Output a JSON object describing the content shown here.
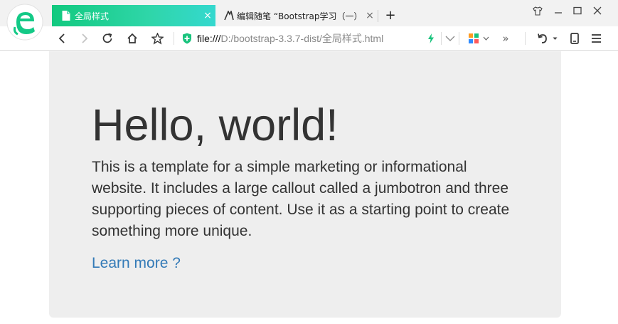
{
  "browser": {
    "tabs": [
      {
        "title": "全局样式",
        "close": "×",
        "active": true
      },
      {
        "title": "编辑随笔 “Bootstrap学习（一）",
        "close": "×",
        "active": false
      }
    ],
    "new_tab": "+",
    "accent_gradient": [
      "#12c97f",
      "#34d8cf"
    ]
  },
  "address_bar": {
    "url_scheme": "file:///",
    "url_path": "D:/bootstrap-3.3.7-dist/全局样式.html",
    "more": "»"
  },
  "page": {
    "heading": "Hello, world!",
    "lead": "This is a template for a simple marketing or informational website. It includes a large callout called a jumbotron and three supporting pieces of content. Use it as a starting point to create something more unique.",
    "link": "Learn more ?",
    "colors": {
      "jumbotron_bg": "#eeeeee",
      "text": "#333333",
      "link": "#337ab7"
    }
  }
}
